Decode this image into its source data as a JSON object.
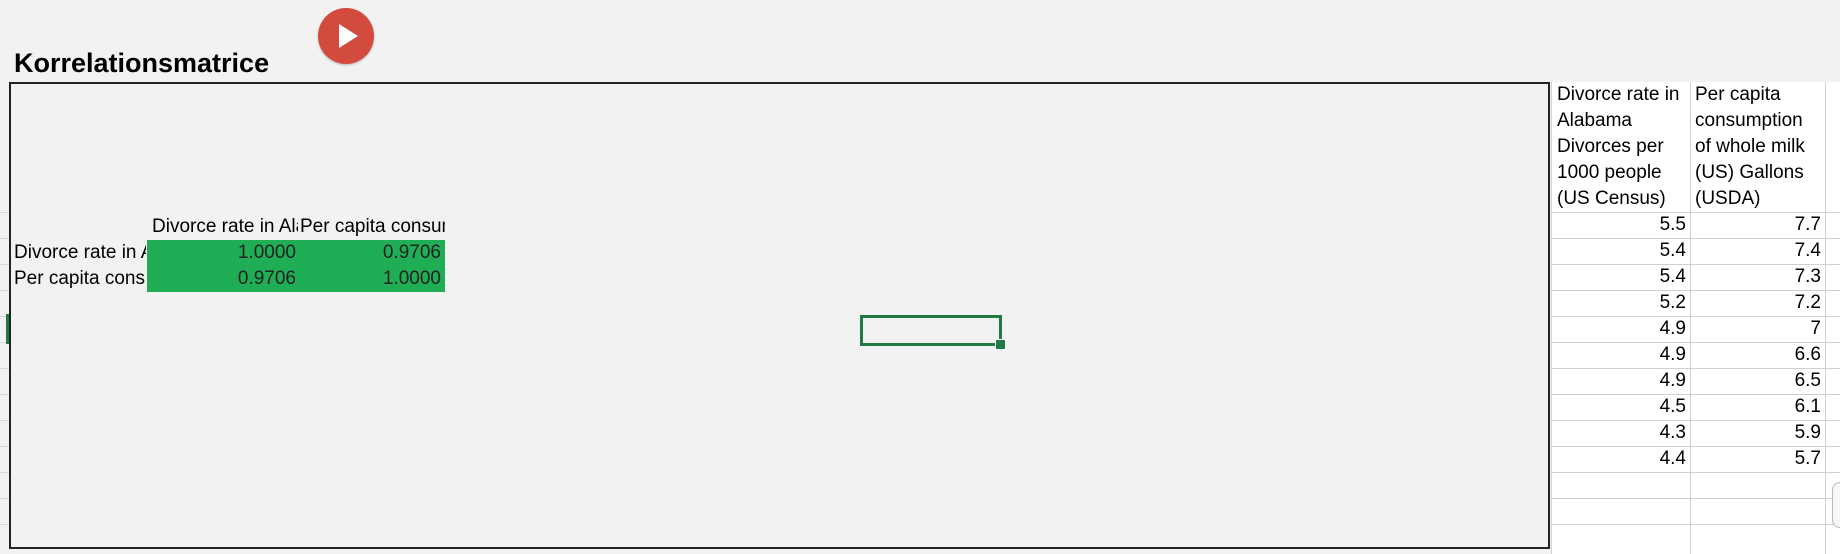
{
  "title": "Korrelationsmatrice",
  "play_button_label": "Play",
  "matrix": {
    "col_headers": [
      "Divorce rate in Alabama",
      "Per capita consumption"
    ],
    "rows": [
      {
        "label": "Divorce rate in Alabama",
        "values": [
          "1.0000",
          "0.9706"
        ]
      },
      {
        "label": "Per capita consumption",
        "values": [
          "0.9706",
          "1.0000"
        ]
      }
    ]
  },
  "sheet": {
    "col_a_header": [
      "Divorce rate in",
      "Alabama",
      "Divorces per",
      "1000 people",
      "(US Census)"
    ],
    "col_b_header": [
      "Per capita",
      "consumption",
      "of whole milk",
      "(US) Gallons",
      "(USDA)"
    ],
    "rows": [
      [
        "5.5",
        "7.7"
      ],
      [
        "5.4",
        "7.4"
      ],
      [
        "5.4",
        "7.3"
      ],
      [
        "5.2",
        "7.2"
      ],
      [
        "4.9",
        "7"
      ],
      [
        "4.9",
        "6.6"
      ],
      [
        "4.9",
        "6.5"
      ],
      [
        "4.5",
        "6.1"
      ],
      [
        "4.3",
        "5.9"
      ],
      [
        "4.4",
        "5.7"
      ]
    ]
  },
  "colors": {
    "accent_green": "#1fad55",
    "selection_green": "#1f7a44",
    "play_red": "#d34a3e"
  }
}
